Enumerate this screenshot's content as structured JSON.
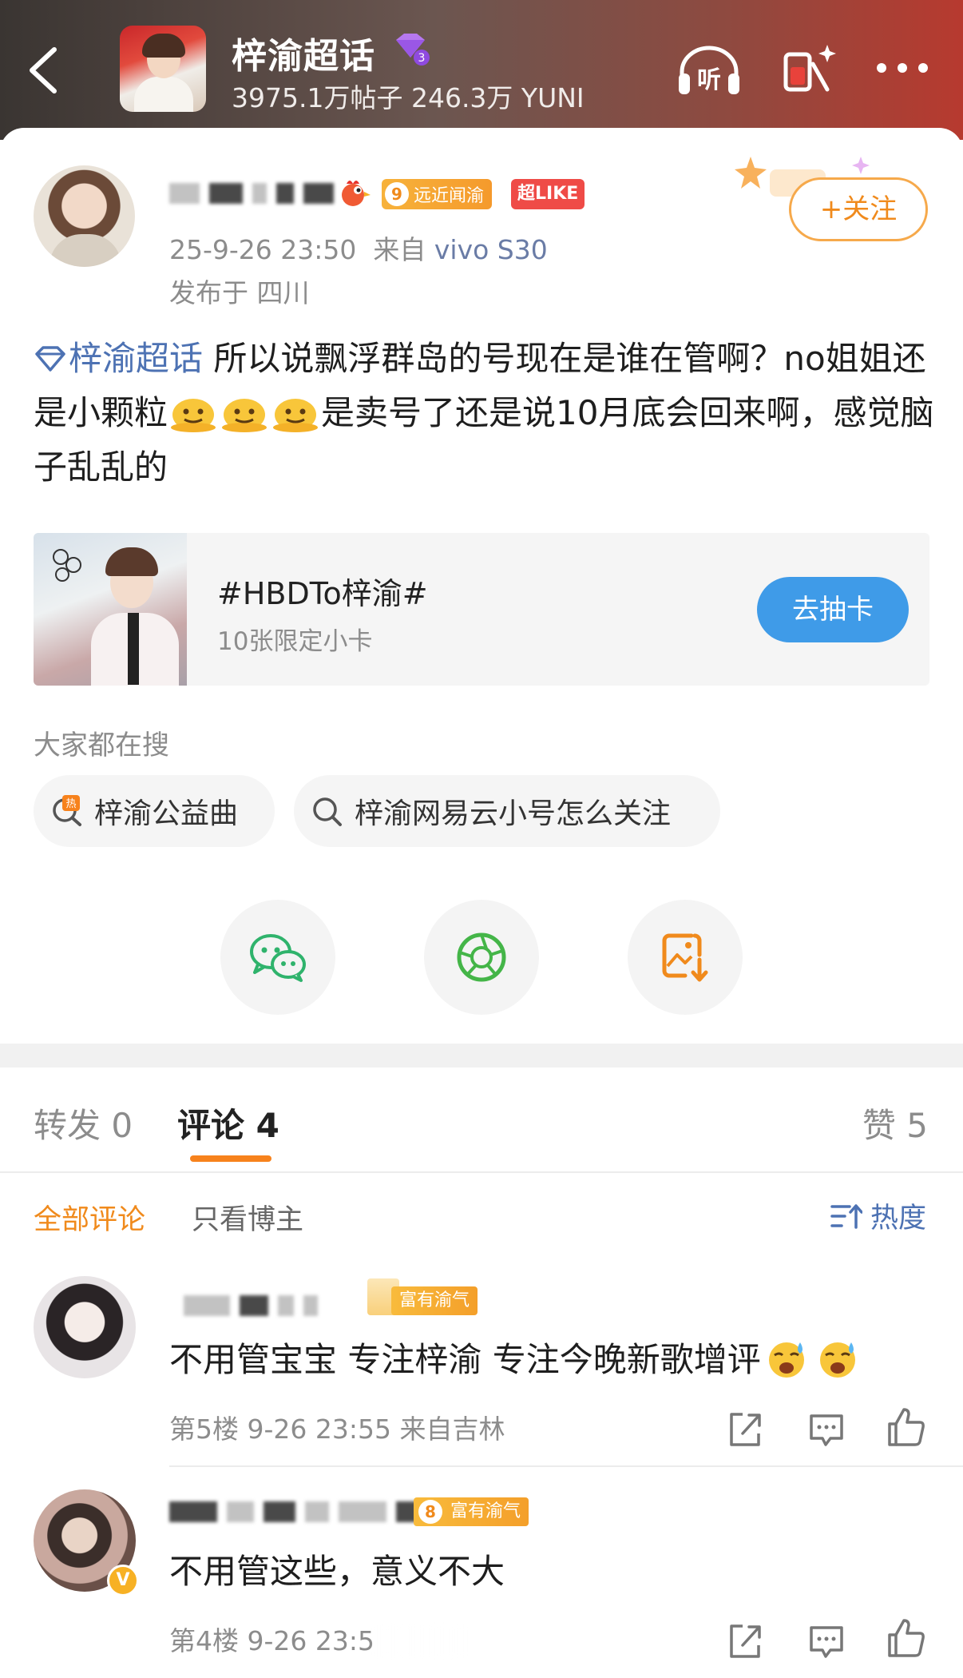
{
  "header": {
    "title": "梓渝超话",
    "stats": "3975.1万帖子 246.3万 YUNI",
    "badge_level": "3",
    "listen_label": "听"
  },
  "post": {
    "level": "9",
    "level_label": "远近闻渝",
    "like_badge": "超LIKE",
    "time": "25-9-26 23:50",
    "source_prefix": "来自",
    "device": "vivo S30",
    "location": "发布于 四川",
    "follow_label": "+关注",
    "topic": "梓渝超话",
    "text_part1": " 所以说飘浮群岛的号现在是谁在管啊？no姐姐还是小颗粒",
    "text_part2": "是卖号了还是说10月底会回来啊，感觉脑子乱乱的"
  },
  "card": {
    "title": "#HBDTo梓渝#",
    "subtitle": "10张限定小卡",
    "button": "去抽卡"
  },
  "search": {
    "label": "大家都在搜",
    "chips": [
      "梓渝公益曲",
      "梓渝网易云小号怎么关注"
    ]
  },
  "tabs": {
    "repost": "转发 0",
    "comments": "评论 4",
    "likes": "赞 5"
  },
  "filters": {
    "all": "全部评论",
    "host_only": "只看博主",
    "sort": "热度"
  },
  "comments": [
    {
      "tag": "富有渝气",
      "text": "不用管宝宝 专注梓渝 专注今晚新歌增评",
      "meta": "第5楼 9-26 23:55 来自吉林"
    },
    {
      "level": "8",
      "tag": "富有渝气",
      "verify": "V",
      "text": "不用管这些，意义不大",
      "meta": "第4楼 9-26 23:5"
    }
  ],
  "colors": {
    "accent": "#f08a1c",
    "link": "#4d72b3",
    "button_blue": "#3f9be8"
  }
}
